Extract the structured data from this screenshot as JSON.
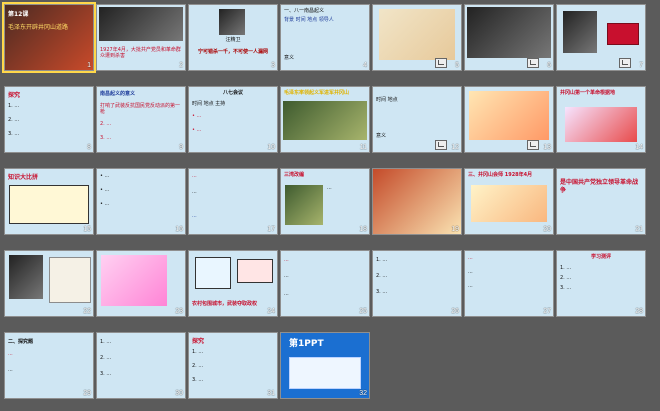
{
  "slides": [
    {
      "n": "1",
      "t1": "第12课",
      "t2": "毛泽东开辟井冈山道路",
      "t3": ""
    },
    {
      "n": "2",
      "t1": "1927年4月，大批共产党员和革命群众遭到杀害",
      "t2": "",
      "t3": ""
    },
    {
      "n": "3",
      "t1": "汪精卫",
      "t2": "宁可错杀一千，不可使一人漏网",
      "t3": ""
    },
    {
      "n": "4",
      "t1": "一、八一南昌起义",
      "t2": "背景 时间 地点 领导人",
      "t3": "意义"
    },
    {
      "n": "5",
      "t1": "",
      "t2": "",
      "t3": ""
    },
    {
      "n": "6",
      "t1": "",
      "t2": "",
      "t3": ""
    },
    {
      "n": "7",
      "t1": "",
      "t2": "",
      "t3": ""
    },
    {
      "n": "8",
      "t1": "",
      "t2": "",
      "t3": ""
    },
    {
      "n": "9",
      "t1": "南昌起义的意义",
      "t2": "打响了武装反抗国民党反动派的第一枪",
      "t3": ""
    },
    {
      "n": "10",
      "t1": "八七会议",
      "t2": "时间 地点 主持",
      "t3": ""
    },
    {
      "n": "11",
      "t1": "毛泽东率领起义军进军井冈山",
      "t2": "",
      "t3": ""
    },
    {
      "n": "12",
      "t1": "时间 地点",
      "t2": "",
      "t3": "意义"
    },
    {
      "n": "13",
      "t1": "",
      "t2": "",
      "t3": ""
    },
    {
      "n": "14",
      "t1": "井冈山第一个革命根据地",
      "t2": "",
      "t3": ""
    },
    {
      "n": "15",
      "t1": "知识大比拼",
      "t2": "",
      "t3": ""
    },
    {
      "n": "16",
      "t1": "",
      "t2": "",
      "t3": ""
    },
    {
      "n": "17",
      "t1": "",
      "t2": "",
      "t3": ""
    },
    {
      "n": "18",
      "t1": "三湾改编",
      "t2": "",
      "t3": ""
    },
    {
      "n": "19",
      "t1": "",
      "t2": "",
      "t3": ""
    },
    {
      "n": "20",
      "t1": "三、井冈山会师 1928年4月",
      "t2": "",
      "t3": ""
    },
    {
      "n": "21",
      "t1": "是中国共产党独立领导革命战争",
      "t2": "",
      "t3": ""
    },
    {
      "n": "22",
      "t1": "",
      "t2": "",
      "t3": ""
    },
    {
      "n": "23",
      "t1": "",
      "t2": "",
      "t3": ""
    },
    {
      "n": "24",
      "t1": "农村包围城市，武装夺取政权",
      "t2": "",
      "t3": ""
    },
    {
      "n": "25",
      "t1": "",
      "t2": "",
      "t3": ""
    },
    {
      "n": "26",
      "t1": "",
      "t2": "",
      "t3": ""
    },
    {
      "n": "27",
      "t1": "",
      "t2": "",
      "t3": ""
    },
    {
      "n": "28",
      "t1": "学习测评",
      "t2": "",
      "t3": ""
    },
    {
      "n": "29",
      "t1": "二、探究题",
      "t2": "",
      "t3": ""
    },
    {
      "n": "30",
      "t1": "",
      "t2": "",
      "t3": ""
    },
    {
      "n": "31",
      "t1": "",
      "t2": "",
      "t3": ""
    },
    {
      "n": "32",
      "t1": "第1PPT",
      "t2": "",
      "t3": ""
    }
  ]
}
